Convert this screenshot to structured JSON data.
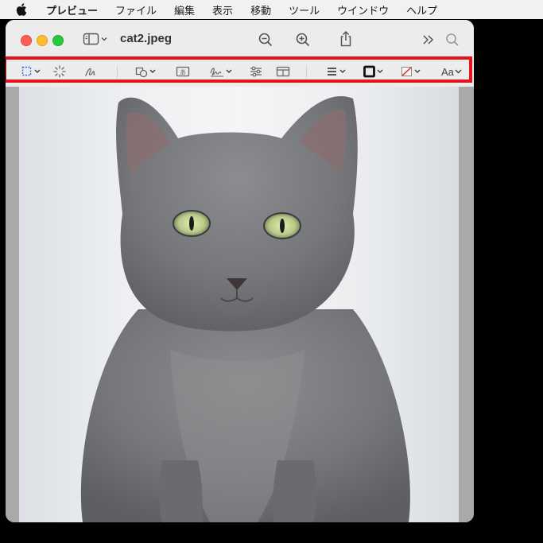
{
  "menubar": {
    "app_name": "プレビュー",
    "items": [
      "ファイル",
      "編集",
      "表示",
      "移動",
      "ツール",
      "ウインドウ",
      "ヘルプ"
    ]
  },
  "window": {
    "title": "cat2.jpeg"
  },
  "markup_toolbar": {
    "text_style_label": "Aa"
  },
  "icons": {
    "titlebar": [
      "sidebar-toggle-icon",
      "zoom-out-icon",
      "zoom-in-icon",
      "share-icon",
      "more-icon",
      "search-icon"
    ],
    "toolbar": [
      "rectangular-selection-icon",
      "instant-alpha-icon",
      "sketch-icon",
      "shapes-icon",
      "text-box-icon",
      "signature-icon",
      "adjust-color-icon",
      "page-layout-icon",
      "line-style-icon",
      "border-color-icon",
      "fill-color-icon",
      "text-style-icon"
    ]
  },
  "colors": {
    "highlight_border": "#e8131a",
    "close": "#ff5f57",
    "minimize": "#febc2e",
    "zoom": "#28c840",
    "selection_accent": "#2f6fe0"
  },
  "image": {
    "subject": "gray cat"
  }
}
